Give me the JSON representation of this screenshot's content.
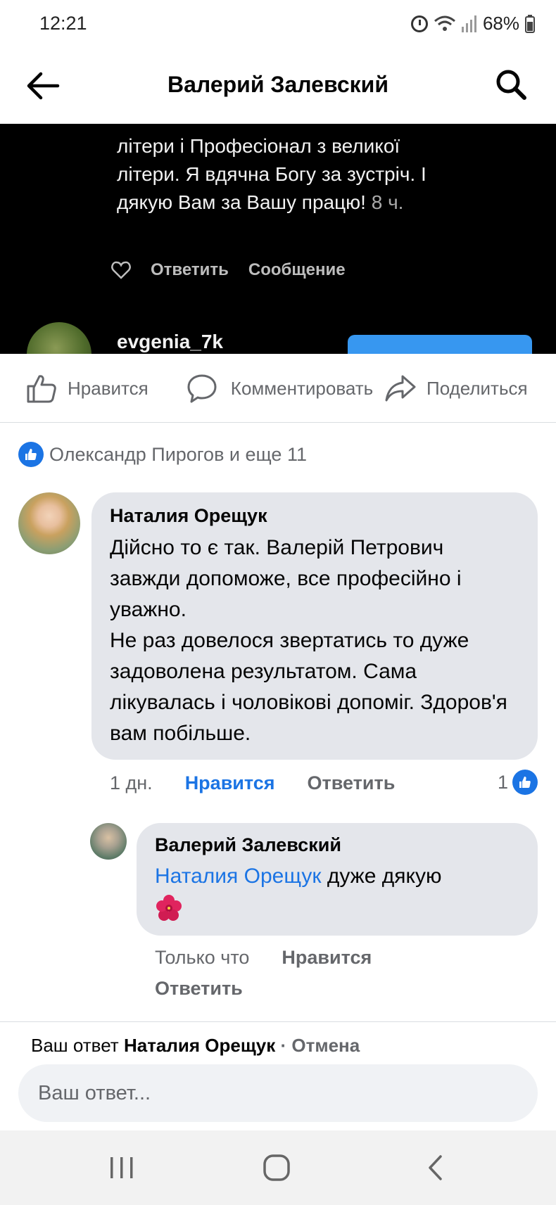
{
  "status_bar": {
    "time": "12:21",
    "battery": "68%",
    "icons": [
      "alarm-icon",
      "wifi-icon",
      "signal-icon",
      "battery-icon"
    ]
  },
  "header": {
    "title": "Валерий Залевский",
    "back_icon": "back-arrow-icon",
    "search_icon": "search-icon"
  },
  "post_image": {
    "text": "літери і Професіонал з великої літери. Я вдячна Богу за зустріч. І дякую Вам за Вашу працю!",
    "time": "8 ч.",
    "reply_label": "Ответить",
    "message_label": "Сообщение",
    "username": "evgenia_7k"
  },
  "actions": {
    "like": "Нравится",
    "comment": "Комментировать",
    "share": "Поделиться"
  },
  "reactions": {
    "summary": "Олександр Пирогов и еще 11"
  },
  "comment": {
    "author": "Наталия Орещук",
    "text": "Дійсно то є так. Валерій Петрович завжди допоможе, все професійно і уважно.\nНе раз довелося звертатись то дуже задоволена результатом. Сама лікувалась і чоловікові допоміг. Здоров'я вам побільше.",
    "time": "1 дн.",
    "like_label": "Нравится",
    "reply_label": "Ответить",
    "reaction_count": "1"
  },
  "reply": {
    "author": "Валерий Залевский",
    "mention": "Наталия Орещук",
    "text": "дуже дякую",
    "emoji": "hibiscus-icon",
    "time": "Только что",
    "like_label": "Нравится",
    "reply_label": "Ответить"
  },
  "composer": {
    "prefix": "Ваш ответ",
    "target": "Наталия Орещук",
    "separator": "·",
    "cancel": "Отмена",
    "placeholder": "Ваш ответ..."
  },
  "colors": {
    "accent": "#1b74e4",
    "secondary_text": "#65676b",
    "bubble": "#e4e6eb"
  }
}
